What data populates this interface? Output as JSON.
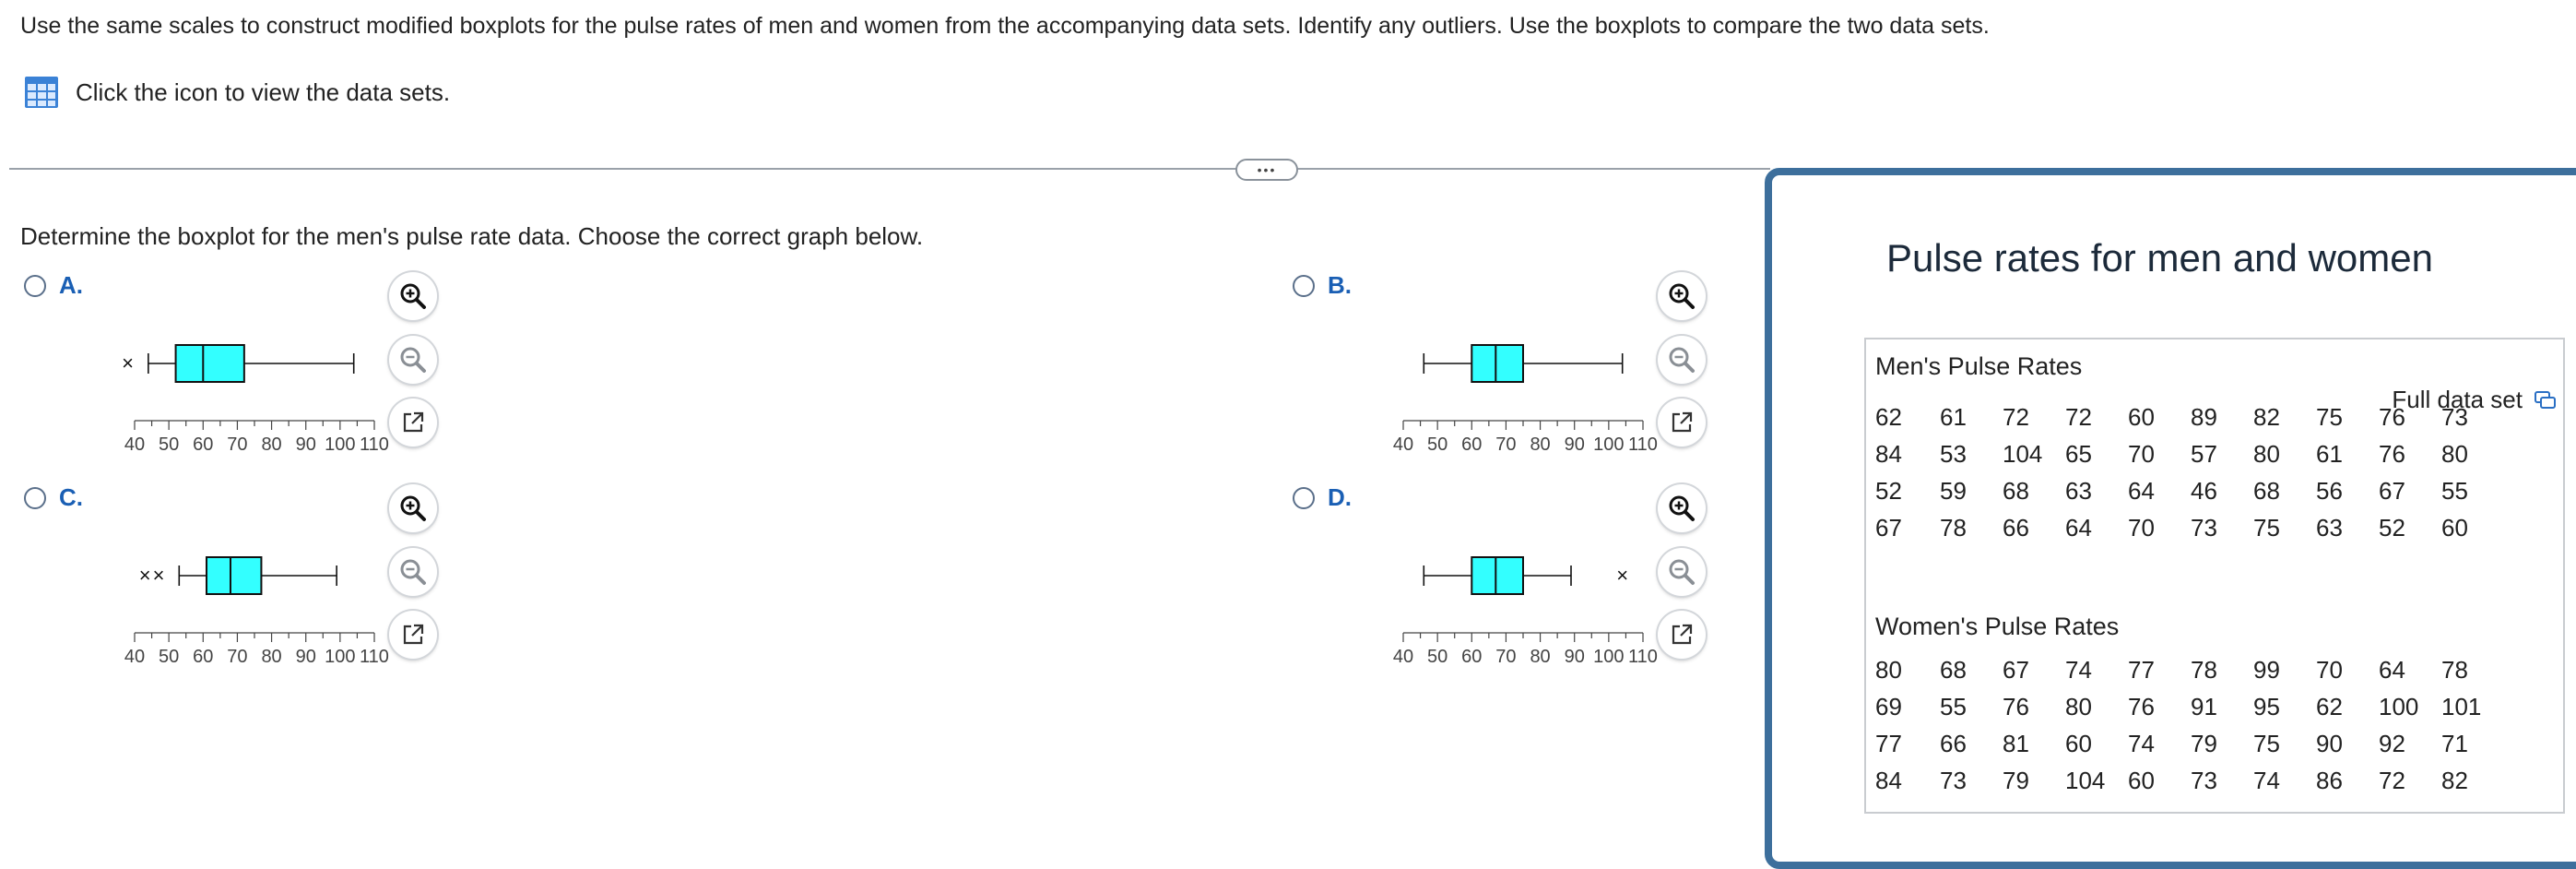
{
  "instructions": "Use the same scales to construct modified boxplots for the pulse rates of men and women from the accompanying data sets. Identify any outliers. Use the boxplots to compare the two data sets.",
  "dataset_link": {
    "icon": "table-icon",
    "label": "Click the icon to view the data sets."
  },
  "divider": {
    "button_label": "•••"
  },
  "question": "Determine the boxplot for the men's pulse rate data. Choose the correct graph below.",
  "axis": {
    "ticks": [
      "40",
      "50",
      "60",
      "70",
      "80",
      "90",
      "100",
      "110"
    ],
    "min": 40,
    "max": 110,
    "minor_step": 5
  },
  "tools": {
    "zoom_in": "zoom-in-icon",
    "zoom_out": "zoom-out-icon",
    "popout": "popout-icon"
  },
  "options": [
    {
      "letter": "A.",
      "boxplot": {
        "whisker_low": 44,
        "q1": 52,
        "median": 60,
        "q3": 72,
        "whisker_high": 104,
        "outliers": [
          38
        ]
      }
    },
    {
      "letter": "B.",
      "boxplot": {
        "whisker_low": 46,
        "q1": 60,
        "median": 67,
        "q3": 75,
        "whisker_high": 104,
        "outliers": []
      }
    },
    {
      "letter": "C.",
      "boxplot": {
        "whisker_low": 53,
        "q1": 61,
        "median": 68,
        "q3": 77,
        "whisker_high": 99,
        "outliers": [
          43,
          47
        ]
      }
    },
    {
      "letter": "D.",
      "boxplot": {
        "whisker_low": 46,
        "q1": 60,
        "median": 67,
        "q3": 75,
        "whisker_high": 89,
        "outliers": [
          104
        ]
      }
    }
  ],
  "panel": {
    "title": "Pulse rates for men and women",
    "men_heading": "Men's Pulse Rates",
    "full_data_label": "Full data set",
    "men_rows": [
      [
        "62",
        "61",
        "72",
        "72",
        "60",
        "89",
        "82",
        "75",
        "76",
        "73"
      ],
      [
        "84",
        "53",
        "104",
        "65",
        "70",
        "57",
        "80",
        "61",
        "76",
        "80"
      ],
      [
        "52",
        "59",
        "68",
        "63",
        "64",
        "46",
        "68",
        "56",
        "67",
        "55"
      ],
      [
        "67",
        "78",
        "66",
        "64",
        "70",
        "73",
        "75",
        "63",
        "52",
        "60"
      ]
    ],
    "women_heading": "Women's Pulse Rates",
    "women_rows": [
      [
        "80",
        "68",
        "67",
        "74",
        "77",
        "78",
        "99",
        "70",
        "64",
        "78"
      ],
      [
        "69",
        "55",
        "76",
        "80",
        "76",
        "91",
        "95",
        "62",
        "100",
        "101"
      ],
      [
        "77",
        "66",
        "81",
        "60",
        "74",
        "79",
        "75",
        "90",
        "92",
        "71"
      ],
      [
        "84",
        "73",
        "79",
        "104",
        "60",
        "73",
        "74",
        "86",
        "72",
        "82"
      ]
    ]
  },
  "colors": {
    "box_fill": "#33ffff",
    "accent": "#1a5fb4",
    "panel_border": "#3d6f9c"
  }
}
